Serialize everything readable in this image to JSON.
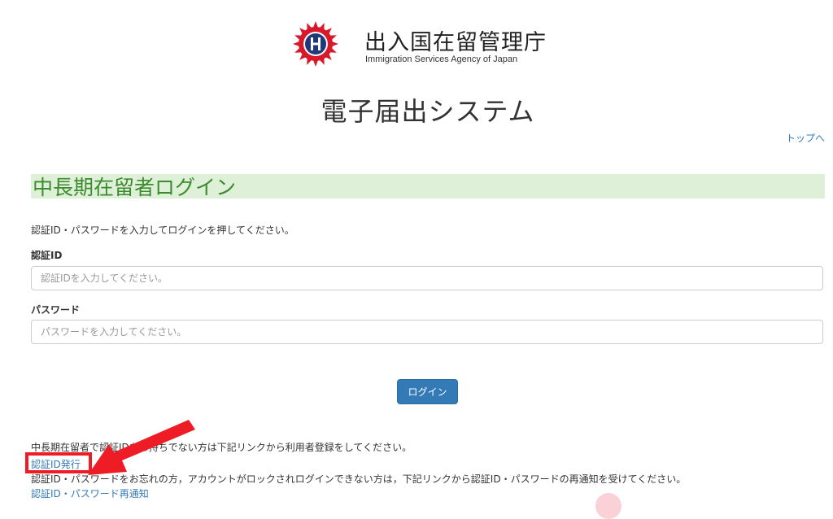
{
  "header": {
    "agency_name_jp": "出入国在留管理庁",
    "agency_name_en": "Immigration Services Agency of Japan",
    "system_title": "電子届出システム",
    "top_link": "トップへ"
  },
  "login": {
    "heading": "中長期在留者ログイン",
    "instruction": "認証ID・パスワードを入力してログインを押してください。",
    "id_label": "認証ID",
    "id_placeholder": "認証IDを入力してください。",
    "password_label": "パスワード",
    "password_placeholder": "パスワードを入力してください。",
    "submit_label": "ログイン"
  },
  "footer": {
    "register_note": "中長期在留者で認証IDをお持ちでない方は下記リンクから利用者登録をしてください。",
    "register_link": "認証ID発行",
    "reset_note": "認証ID・パスワードをお忘れの方，アカウントがロックされログインできない方は，下記リンクから認証ID・パスワードの再通知を受けてください。",
    "reset_link": "認証ID・パスワード再通知"
  },
  "colors": {
    "accent": "#337ab7",
    "heading_bg": "#dff0d8",
    "heading_text": "#3c8a2e",
    "annotation": "#ee1c24"
  },
  "icons": {
    "logo": "agency-emblem-icon",
    "annotation_arrow": "red-arrow-icon"
  }
}
